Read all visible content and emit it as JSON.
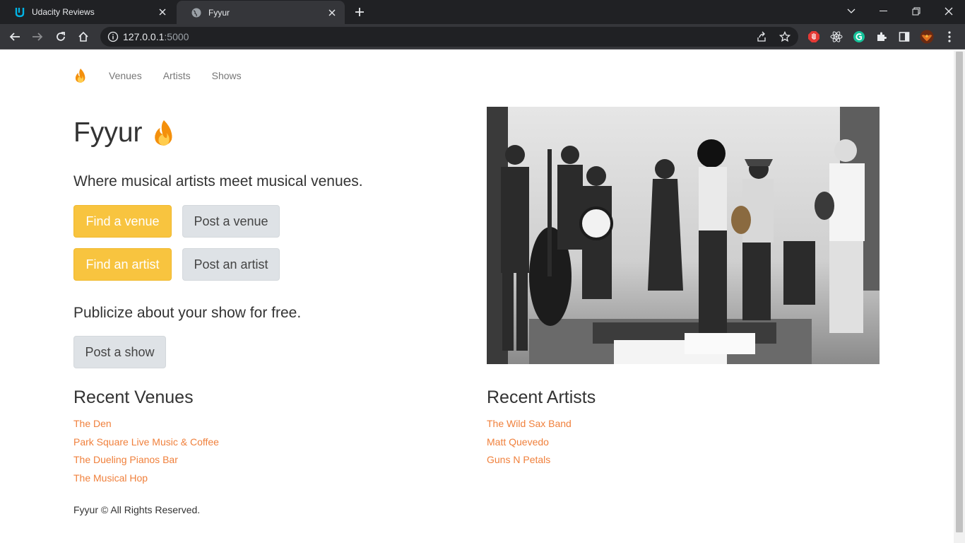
{
  "browser": {
    "tabs": [
      {
        "title": "Udacity Reviews",
        "active": false,
        "icon": "udacity-logo-icon"
      },
      {
        "title": "Fyyur",
        "active": true,
        "icon": "globe-icon"
      }
    ],
    "url_host": "127.0.0.1",
    "url_port": ":5000",
    "accent": "#202124"
  },
  "page": {
    "nav": {
      "links": [
        "Venues",
        "Artists",
        "Shows"
      ]
    },
    "hero": {
      "title": "Fyyur",
      "lead": "Where musical artists meet musical venues.",
      "buttons": {
        "find_venue": "Find a venue",
        "post_venue": "Post a venue",
        "find_artist": "Find an artist",
        "post_artist": "Post an artist",
        "post_show": "Post a show"
      },
      "lead2": "Publicize about your show for free."
    },
    "recent_venues": {
      "title": "Recent Venues",
      "items": [
        "The Den",
        "Park Square Live Music & Coffee",
        "The Dueling Pianos Bar",
        "The Musical Hop"
      ]
    },
    "recent_artists": {
      "title": "Recent Artists",
      "items": [
        "The Wild Sax Band",
        "Matt Quevedo",
        "Guns N Petals"
      ]
    },
    "footer": "Fyyur © All Rights Reserved.",
    "colors": {
      "primary": "#f8c43f",
      "link": "#f0803c",
      "secondary": "#dee2e6"
    }
  }
}
